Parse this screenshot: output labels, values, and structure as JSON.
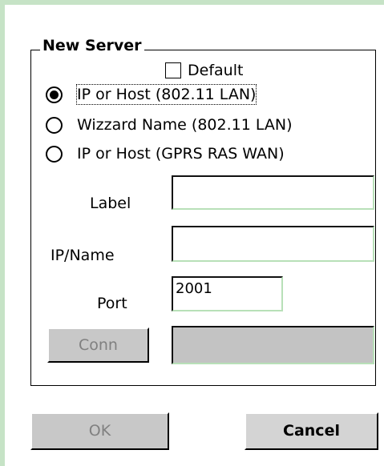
{
  "dialog": {
    "group_title": "New Server",
    "default_label": "Default",
    "default_checked": false,
    "modes": [
      {
        "label": "IP or Host (802.11 LAN)",
        "selected": true
      },
      {
        "label": "Wizzard Name (802.11 LAN)",
        "selected": false
      },
      {
        "label": "IP or Host (GPRS RAS WAN)",
        "selected": false
      }
    ],
    "label_field": {
      "label": "Label",
      "value": ""
    },
    "ipname_field": {
      "label": "IP/Name",
      "value": ""
    },
    "port_field": {
      "label": "Port",
      "value": "2001"
    },
    "conn_button_label": "Conn",
    "conn_status_value": ""
  },
  "footer": {
    "ok_label": "OK",
    "cancel_label": "Cancel"
  }
}
